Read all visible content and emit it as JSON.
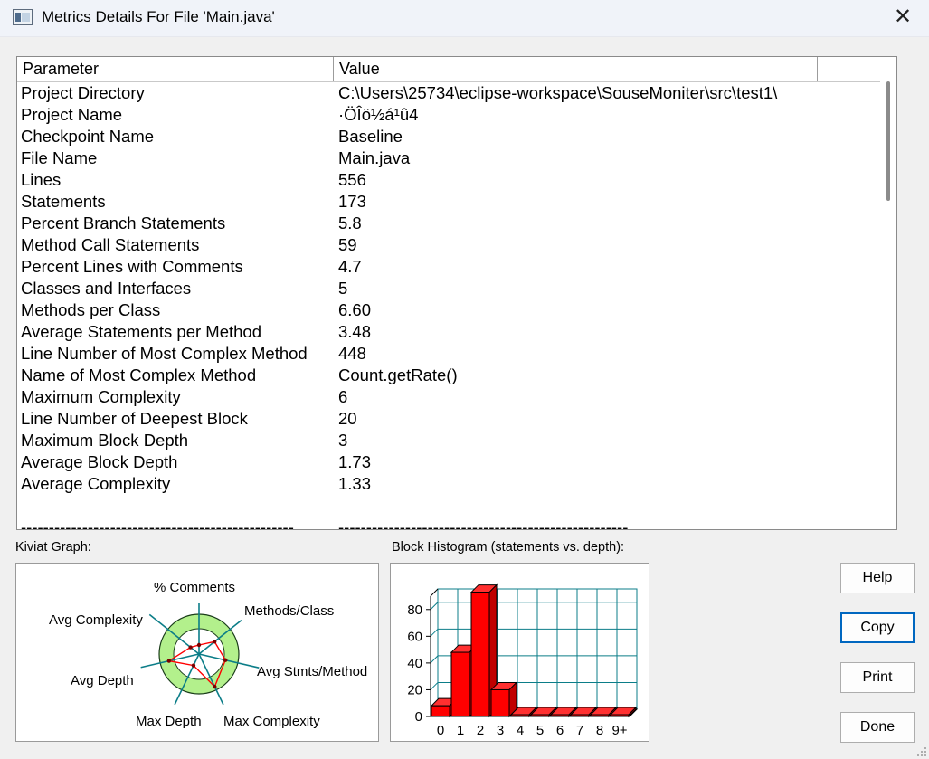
{
  "window": {
    "title": "Metrics Details For File 'Main.java'"
  },
  "table": {
    "headers": [
      "Parameter",
      "Value",
      ""
    ],
    "rows": [
      [
        "Project Directory",
        "C:\\Users\\25734\\eclipse-workspace\\SouseMoniter\\src\\test1\\"
      ],
      [
        "Project Name",
        "·ÖÎö½á¹û4"
      ],
      [
        "Checkpoint Name",
        "Baseline"
      ],
      [
        "File Name",
        "Main.java"
      ],
      [
        "Lines",
        "556"
      ],
      [
        "Statements",
        "173"
      ],
      [
        "Percent Branch Statements",
        "5.8"
      ],
      [
        "Method Call Statements",
        "59"
      ],
      [
        "Percent Lines with Comments",
        "4.7"
      ],
      [
        "Classes and Interfaces",
        "5"
      ],
      [
        "Methods per Class",
        "6.60"
      ],
      [
        "Average Statements per Method",
        "3.48"
      ],
      [
        "Line Number of Most Complex Method",
        "448"
      ],
      [
        "Name of Most Complex Method",
        "Count.getRate()"
      ],
      [
        "Maximum Complexity",
        "6"
      ],
      [
        "Line Number of Deepest Block",
        "20"
      ],
      [
        "Maximum Block Depth",
        "3"
      ],
      [
        "Average Block Depth",
        "1.73"
      ],
      [
        "Average Complexity",
        "1.33"
      ],
      [
        "",
        ""
      ],
      [
        "-------------------------------------------------",
        "----------------------------------------------------"
      ]
    ]
  },
  "kiviat": {
    "label": "Kiviat Graph:",
    "axes": [
      "% Comments",
      "Methods/Class",
      "Avg Stmts/Method",
      "Max Complexity",
      "Max Depth",
      "Avg Depth",
      "Avg Complexity"
    ]
  },
  "histogram": {
    "label": "Block Histogram (statements vs. depth):"
  },
  "buttons": {
    "help": "Help",
    "copy": "Copy",
    "print": "Print",
    "done": "Done"
  },
  "colors": {
    "bar": "#ff0000",
    "grid": "#0b7d88",
    "ring": "#b3f08c"
  },
  "chart_data": {
    "type": "bar",
    "title": "Block Histogram (statements vs. depth):",
    "categories": [
      "0",
      "1",
      "2",
      "3",
      "4",
      "5",
      "6",
      "7",
      "8",
      "9+"
    ],
    "values": [
      8,
      48,
      93,
      20,
      1,
      1,
      1,
      1,
      1,
      1
    ],
    "yticks": [
      0,
      20,
      40,
      60,
      80
    ],
    "ylim": [
      0,
      90
    ],
    "grid": true
  }
}
